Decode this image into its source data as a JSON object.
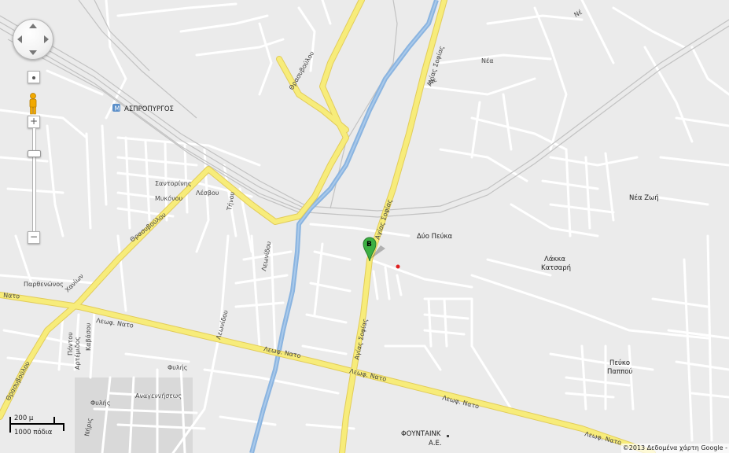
{
  "map": {
    "station_name": "ΑΣΠΡΟΠΥΡΓΟΣ",
    "places": {
      "dyo_peuka": "Δύο Πεύκα",
      "nea_zoi": "Νέα Ζωή",
      "lakka": "Λάκκα",
      "katsari": "Κατσαρή",
      "peuko": "Πεύκο",
      "pappou": "Παππού",
      "fountaink": "ΦΟΥΝΤΑΙΝΚ",
      "ae": "Α.Ε."
    },
    "roads": {
      "thrasyvoulou": "Θρασυβούλου",
      "agias_sofias": "Αγίας Σοφίας",
      "leof_nato": "Λεωφ. Νατο",
      "nato": "Νατο",
      "santorinis": "Σαντορίνης",
      "mykonou": "Μυκόνου",
      "lesvou": "Λέσβου",
      "tinou": "Τήνου",
      "leonidou": "Λεωνίδου",
      "parthenonos": "Παρθενώνος",
      "chanion": "Χανίων",
      "pontou": "Πόντου",
      "artemidos": "Αρτέμιδος",
      "kavasou": "Καβάσου",
      "fylis": "Φυλής",
      "anagenniseos": "Αναγεννήσεως",
      "niris": "Νήρις",
      "ne": "Νέ",
      "nee": "Νέα",
      "ne2": "Νε"
    },
    "marker_label": "B"
  },
  "controls": {
    "zoom_in": "+",
    "zoom_out": "−"
  },
  "scale": {
    "metric": "200 μ",
    "imperial": "1000 πόδια"
  },
  "copyright": "©2013 Δεδομένα χάρτη Google -",
  "colors": {
    "background": "#ebebeb",
    "minor_road": "#ffffff",
    "major_road": "#f7ec7a",
    "major_road_edge": "#e2cc5a",
    "river": "#8ab4e0",
    "railway": "#bdbdbd",
    "marker": "#3cb043"
  }
}
